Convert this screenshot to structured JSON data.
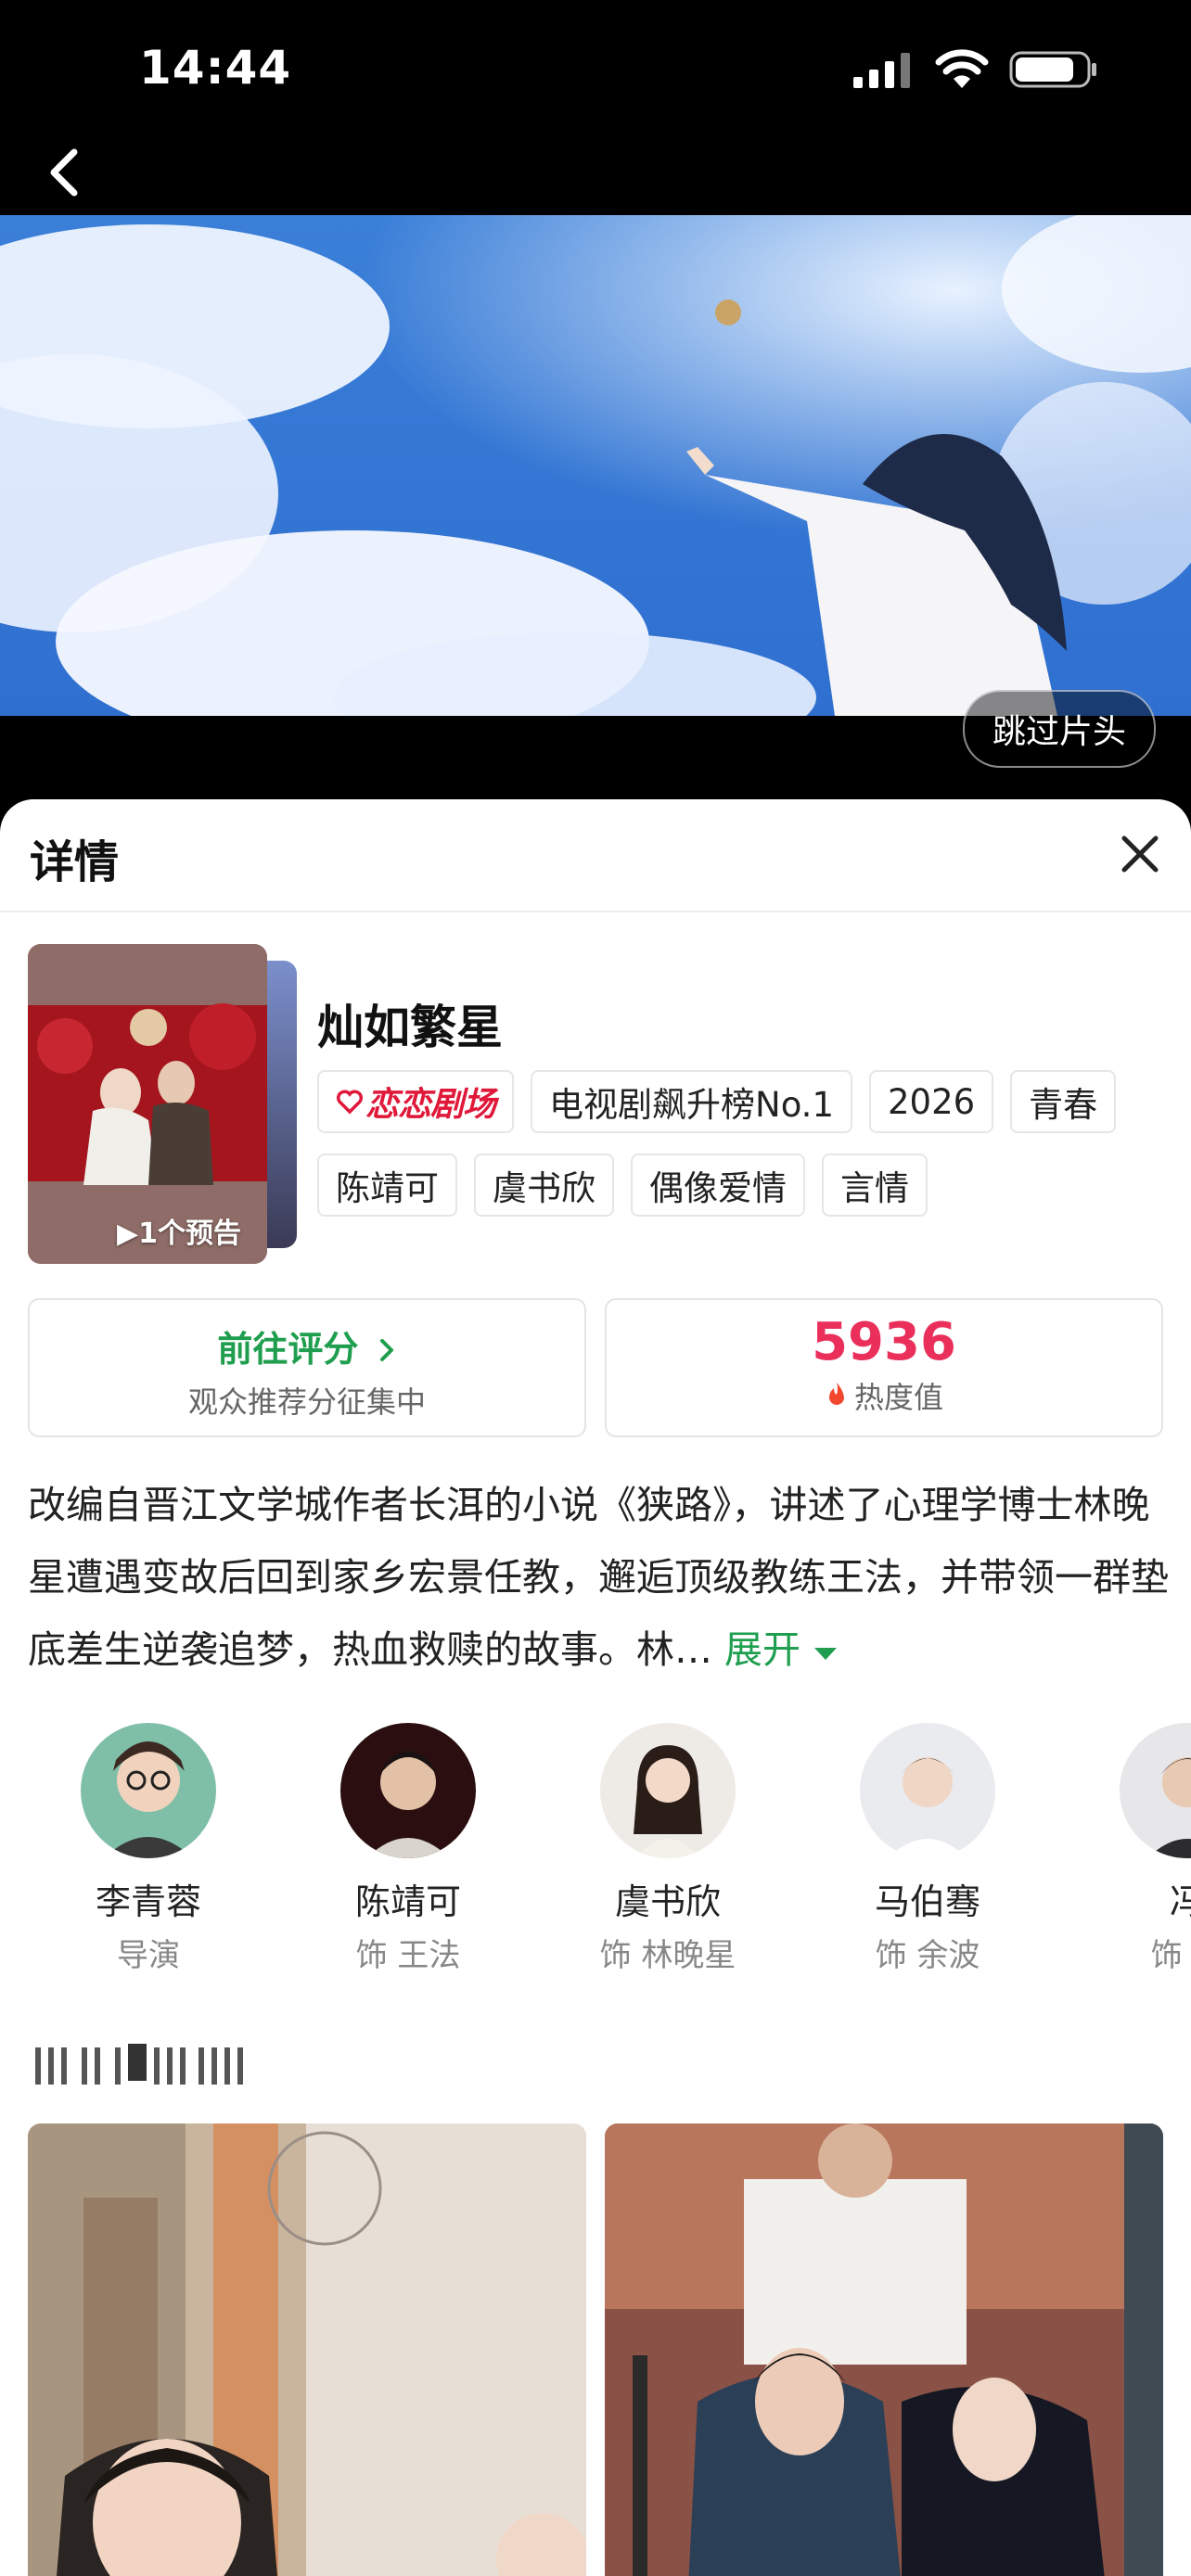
{
  "status_bar": {
    "time": "14:44"
  },
  "hero": {
    "skip_label": "跳过片头"
  },
  "sheet": {
    "title": "详情"
  },
  "show": {
    "title": "灿如繁星",
    "trailer_label": "▶1个预告",
    "brand_tag": "恋恋剧场",
    "tags": [
      "电视剧飙升榜No.1",
      "2026",
      "青春",
      "陈靖可",
      "虞书欣",
      "偶像爱情",
      "言情"
    ]
  },
  "rating_card": {
    "label": "前往评分",
    "sub": "观众推荐分征集中"
  },
  "heat_card": {
    "value": "5936",
    "sub": "热度值"
  },
  "description": {
    "text": "改编自晋江文学城作者长洱的小说《狭路》，讲述了心理学博士林晚星遭遇变故后回到家乡宏景任教，邂逅顶级教练王法，并带领一群垫底差生逆袭追梦，热血救赎的故事。林…",
    "more_label": "展开"
  },
  "cast": [
    {
      "name": "李青蓉",
      "role": "导演"
    },
    {
      "name": "陈靖可",
      "role": "饰 王法"
    },
    {
      "name": "虞书欣",
      "role": "饰 林晚星"
    },
    {
      "name": "马伯骞",
      "role": "饰 余波"
    },
    {
      "name": "冯",
      "role": "饰 王"
    }
  ]
}
